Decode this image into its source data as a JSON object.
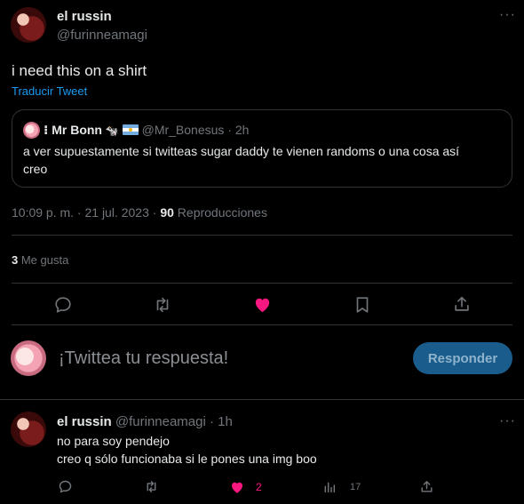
{
  "main_tweet": {
    "author_name": "el russin",
    "author_handle": "@furinneamagi",
    "text": "i need this on a shirt",
    "translate_label": "Traducir Tweet",
    "time": "10:09 p. m. · 21 jul. 2023 · ",
    "views_count": "90",
    "views_label": " Reproducciones",
    "likes_count": "3",
    "likes_label": " Me gusta"
  },
  "quoted_tweet": {
    "author_name": "Mr Bonn",
    "author_handle": "@Mr_Bonesus",
    "time": "· 2h",
    "text_line1": "a ver supuestamente si twitteas sugar daddy te vienen randoms o una cosa así",
    "text_line2": "creo"
  },
  "compose": {
    "placeholder": "¡Twittea tu respuesta!",
    "reply_button": "Responder"
  },
  "reply": {
    "author_name": "el russin",
    "author_handle": "@furinneamagi",
    "time": "· 1h",
    "line1": "no para soy pendejo",
    "line2": "creo q sólo funcionaba si le pones una img boo",
    "like_count": "2",
    "views_count": "17"
  },
  "colors": {
    "background": "#000000",
    "text": "#e7e9ea",
    "muted": "#71767b",
    "link": "#1d9bf0",
    "like": "#f91880",
    "divider": "#2f3336",
    "reply_button_bg": "#1a5d8c"
  },
  "icons": [
    "more-icon",
    "reply-icon",
    "retweet-icon",
    "like-icon",
    "bookmark-icon",
    "share-icon",
    "views-icon"
  ]
}
